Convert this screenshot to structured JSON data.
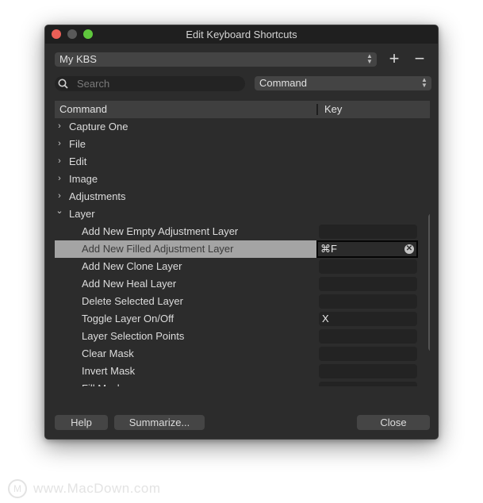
{
  "window": {
    "title": "Edit Keyboard Shortcuts"
  },
  "kbs_select": {
    "value": "My KBS"
  },
  "toolbar": {
    "add_label": "+",
    "remove_label": "−"
  },
  "search": {
    "placeholder": "Search",
    "value": ""
  },
  "filter_select": {
    "value": "Command"
  },
  "table": {
    "headers": {
      "command": "Command",
      "key": "Key"
    },
    "groups": [
      {
        "label": "Capture One",
        "expanded": false
      },
      {
        "label": "File",
        "expanded": false
      },
      {
        "label": "Edit",
        "expanded": false
      },
      {
        "label": "Image",
        "expanded": false
      },
      {
        "label": "Adjustments",
        "expanded": false
      },
      {
        "label": "Layer",
        "expanded": true
      }
    ],
    "layer_items": [
      {
        "label": "Add New Empty Adjustment Layer",
        "key": ""
      },
      {
        "label": "Add New Filled Adjustment Layer",
        "key": "⌘F",
        "selected": true
      },
      {
        "label": "Add New Clone Layer",
        "key": ""
      },
      {
        "label": "Add New Heal Layer",
        "key": ""
      },
      {
        "label": "Delete Selected Layer",
        "key": ""
      },
      {
        "label": "Toggle Layer On/Off",
        "key": "X"
      },
      {
        "label": "Layer Selection Points",
        "key": ""
      },
      {
        "label": "Clear Mask",
        "key": ""
      },
      {
        "label": "Invert Mask",
        "key": ""
      },
      {
        "label": "Fill Mask",
        "key": ""
      }
    ]
  },
  "icons": {
    "chevron_right": "›",
    "chevron_down": "⌄",
    "clear": "✕",
    "updown": "⌃⌄"
  },
  "buttons": {
    "help": "Help",
    "summarize": "Summarize...",
    "close": "Close"
  },
  "watermark": {
    "logo": "M",
    "text": "www.MacDown.com"
  }
}
